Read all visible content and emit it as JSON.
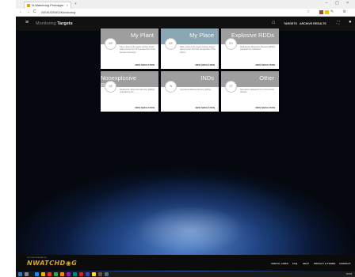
{
  "browser": {
    "tab_title": "N-Watchdog Prototype",
    "tab_close": "×",
    "new_tab": "+",
    "window_controls": "– ▢ ×",
    "back": "←",
    "forward": "→",
    "refresh": "C",
    "url": "/NSIS/DEMO/Monitoring",
    "toolbar_icons": "☆ ≡ ✎ ⚙"
  },
  "app": {
    "menu_icon": "≡",
    "title_prefix": "Monitoring",
    "title_main": "Targets",
    "home_icon": "⌂",
    "nav": {
      "targets": "TARGETS",
      "archive": "ARCHIVE RESULTS"
    },
    "expand_icon": "⛶",
    "user_icon": "●"
  },
  "cards": [
    {
      "title": "My Plant",
      "avatar": "MP",
      "desc": "Take a look at the region surface power safety issues from the perspective of the Nuclear Operators.",
      "action": "NEW SIMULATION"
    },
    {
      "title": "My Place",
      "avatar": "MP",
      "desc": "Take a look at the region surface power safety issues from the perspective of the citizen.",
      "action": "NEW SIMULATION"
    },
    {
      "title": "Explosive RDDs",
      "avatar": "ER",
      "desc": "Radioactive Dispersion Devices (RDDs) propelled by explosives.",
      "action": "NEW SIMULATION"
    },
    {
      "title": "Nonexplosive RDDs",
      "avatar": "NE",
      "desc": "Radioactive Dispersion Devices (RDDs) propelled by fire.",
      "action": "NEW SIMULATION"
    },
    {
      "title": "INDs",
      "avatar": "IN",
      "desc": "Improvised Nuclear Devices (INDs).",
      "action": "NEW SIMULATION"
    },
    {
      "title": "Other",
      "avatar": "OT",
      "desc": "Scenarios originated from Commercial devices.",
      "action": "NEW SIMULATION"
    }
  ],
  "footer": {
    "logo_text": "NWATCHD◉G",
    "logo_small": "NUCLEAR DATA ANALYSIS",
    "links": [
      "USEFUL LINKS",
      "FAQ",
      "HELP",
      "PRIVACY & TERMS",
      "CONTACT"
    ]
  },
  "taskbar": {
    "clock": "19:58"
  },
  "colors": {
    "card_head": "#9e9e9e",
    "appbar": "#111111",
    "logo": "#d7a72b"
  }
}
